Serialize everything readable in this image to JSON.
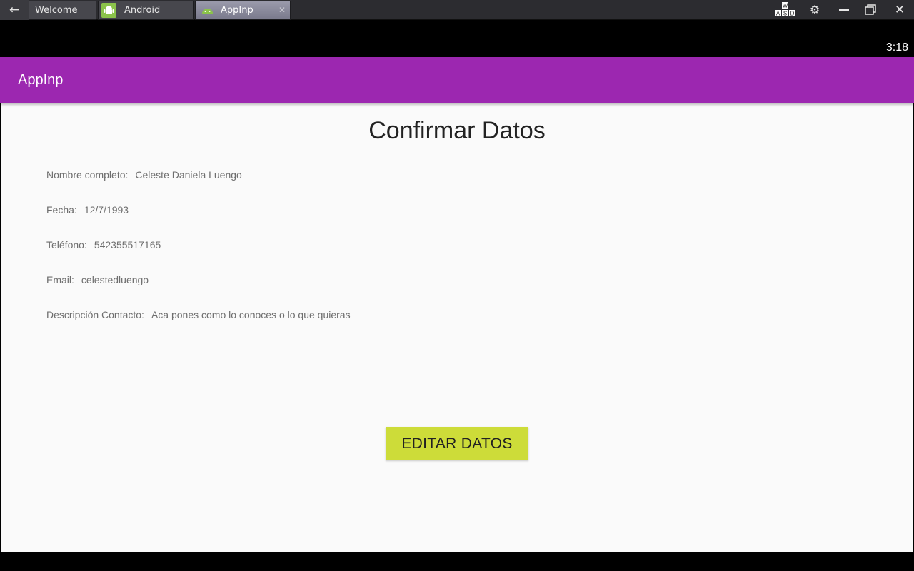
{
  "emulator": {
    "tabs": [
      {
        "label": "Welcome"
      },
      {
        "label": "Android"
      },
      {
        "label": "AppInp"
      }
    ],
    "keys_icon_letters": "W A S D",
    "icons": {
      "back": "back-arrow-icon",
      "settings": "gear-icon",
      "minimize": "minimize-icon",
      "restore": "restore-icon",
      "close": "close-icon"
    }
  },
  "status_bar": {
    "time": "3:18"
  },
  "app": {
    "title": "AppInp",
    "toolbar_color": "#9c27b0"
  },
  "screen": {
    "title": "Confirmar Datos",
    "fields": [
      {
        "label": "Nombre completo:",
        "value": "Celeste Daniela Luengo"
      },
      {
        "label": "Fecha:",
        "value": "12/7/1993"
      },
      {
        "label": "Teléfono:",
        "value": "542355517165"
      },
      {
        "label": "Email:",
        "value": "celestedluengo"
      },
      {
        "label": "Descripción Contacto:",
        "value": "Aca pones como lo conoces o lo que quieras"
      }
    ],
    "edit_button": {
      "label": "EDITAR DATOS",
      "color": "#cddc39"
    }
  }
}
